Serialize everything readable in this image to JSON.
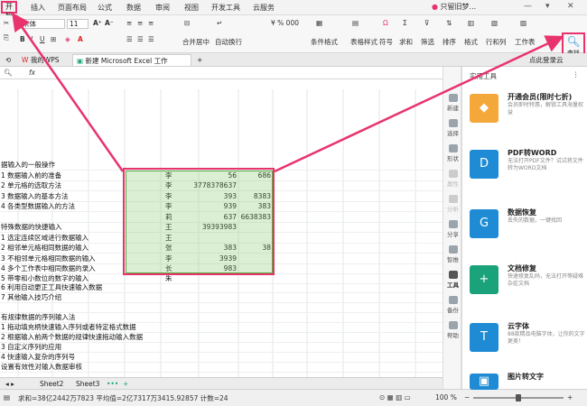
{
  "menubar": {
    "start": "开始",
    "items": [
      "插入",
      "页面布局",
      "公式",
      "数据",
      "审阅",
      "视图",
      "开发工具",
      "云服务"
    ],
    "account": "只留旧梦..."
  },
  "ribbon": {
    "font_name": "宋体",
    "font_size": "11",
    "merge_center": "合并居中",
    "wrap_text": "自动换行",
    "conditional_format": "条件格式",
    "table_style": "表格样式",
    "symbol": "符号",
    "sum": "求和",
    "filter": "筛选",
    "sort": "排序",
    "format": "格式",
    "rows_cols": "行和列",
    "sheet": "工作表",
    "find": "查找"
  },
  "tabs": {
    "wps": "我的WPS",
    "file": "新建 Microsoft Excel 工作表.xlsx",
    "login": "点此登录云"
  },
  "formula": {
    "fx": "fx"
  },
  "columns": [
    "B",
    "C",
    "D",
    "E",
    "F",
    "G",
    "H",
    "I",
    "J",
    "K",
    "L",
    "M"
  ],
  "rows": [
    {
      "a": "据输入的一般操作",
      "g": "",
      "h": "",
      "i": ""
    },
    {
      "a": "1 数据输入前的准备",
      "g": "李",
      "h": "56",
      "i": "686"
    },
    {
      "a": "2 单元格的选取方法",
      "g": "李",
      "h": "3778378637",
      "i": ""
    },
    {
      "a": "3 数据输入的基本方法",
      "g": "李",
      "h": "393",
      "i": "8383"
    },
    {
      "a": "4 各类型数据输入的方法",
      "g": "李",
      "h": "939",
      "i": "383"
    },
    {
      "a": "",
      "g": "莉",
      "h": "637",
      "i": "6638383"
    },
    {
      "a": "特殊数据的快捷输入",
      "g": "王",
      "h": "39393983",
      "i": ""
    },
    {
      "a": "1 选定连续区域进行数据输入",
      "g": "王",
      "h": "",
      "i": ""
    },
    {
      "a": "2 相邻单元格相同数据的输入",
      "g": "张",
      "h": "383",
      "i": "38"
    },
    {
      "a": "3 不相邻单元格相同数据的输入",
      "g": "李",
      "h": "3939",
      "i": ""
    },
    {
      "a": "4 多个工作表中相同数据的录入",
      "g": "长",
      "h": "983",
      "i": ""
    },
    {
      "a": "5 带零和小数位的数字的输入",
      "g": "朱",
      "h": "",
      "i": ""
    },
    {
      "a": "6 利用自动更正工具快速输入数据",
      "g": "",
      "h": "",
      "i": ""
    },
    {
      "a": "7 其他输入技巧介绍",
      "g": "",
      "h": "",
      "i": ""
    },
    {
      "a": "",
      "g": "",
      "h": "",
      "i": ""
    },
    {
      "a": "有规律数据的序列输入法",
      "g": "",
      "h": "",
      "i": ""
    },
    {
      "a": "1 拖动填充柄快速输入序列或者特定格式数据",
      "g": "",
      "h": "",
      "i": ""
    },
    {
      "a": "2 根据输入前两个数据的规律快速拖动输入数据",
      "g": "",
      "h": "",
      "i": ""
    },
    {
      "a": "3 自定义序列的应用",
      "g": "",
      "h": "",
      "i": ""
    },
    {
      "a": "4 快速输入复杂的序列号",
      "g": "",
      "h": "",
      "i": ""
    },
    {
      "a": "设置有效性对输入数据审核",
      "g": "",
      "h": "",
      "i": ""
    }
  ],
  "sheets": [
    "Sheet2",
    "Sheet3"
  ],
  "status": {
    "text": "求和=38亿2442万7823   平均值=2亿7317万3415.92857   计数=24",
    "zoom": "100 %"
  },
  "rail": [
    "新建",
    "选择",
    "形状",
    "属性",
    "分析",
    "分享",
    "智推",
    "工具",
    "备份",
    "帮助"
  ],
  "panel": {
    "title": "实用工具",
    "tools": [
      {
        "title": "开通会员(限时七折)",
        "desc": "会员即时特惠，解锁工具海量权益",
        "color": "#f4a83a",
        "glyph": "◆"
      },
      {
        "title": "PDF转WORD",
        "desc": "无法打开PDF文件？试试将文件转为WORD文档",
        "color": "#1e8bd4",
        "glyph": "D"
      },
      {
        "title": "数据恢复",
        "desc": "丢失的数据，一键找回",
        "color": "#1e8bd4",
        "glyph": "G"
      },
      {
        "title": "文档修复",
        "desc": "快速修复乱码，无法打开等疑难杂症文档",
        "color": "#1aa37a",
        "glyph": "+"
      },
      {
        "title": "云字体",
        "desc": "88款精品电脑字体，让你的文字更美！",
        "color": "#1e8bd4",
        "glyph": "T"
      },
      {
        "title": "图片转文字",
        "desc": "",
        "color": "#1e8bd4",
        "glyph": "▣"
      }
    ]
  }
}
